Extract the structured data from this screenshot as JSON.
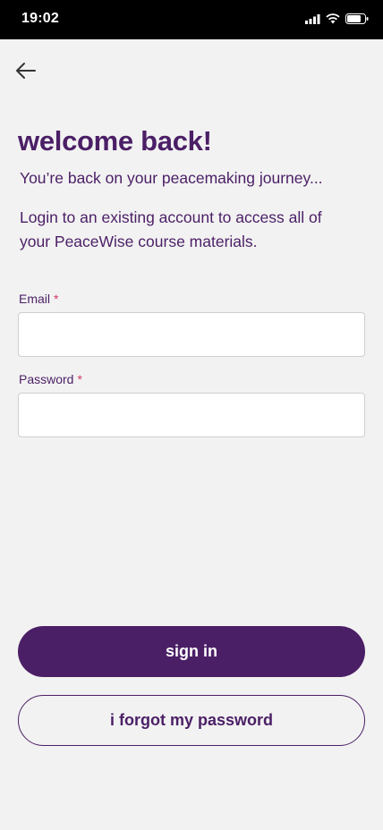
{
  "status_bar": {
    "time": "19:02",
    "icons": [
      "signal-icon",
      "wifi-icon",
      "battery-icon"
    ]
  },
  "nav": {
    "back_icon": "arrow-left-icon"
  },
  "heading": {
    "title": "welcome back!",
    "subtitle": "You’re back on your peacemaking journey...",
    "description": "Login to an existing account to access all of your PeaceWise course materials."
  },
  "form": {
    "email": {
      "label": "Email",
      "required_mark": "*",
      "value": ""
    },
    "password": {
      "label": "Password",
      "required_mark": "*",
      "value": ""
    }
  },
  "actions": {
    "sign_in": "sign in",
    "forgot_password": "i forgot my password"
  },
  "colors": {
    "brand": "#4b1f66",
    "required": "#d23a63",
    "background": "#f2f2f2"
  }
}
